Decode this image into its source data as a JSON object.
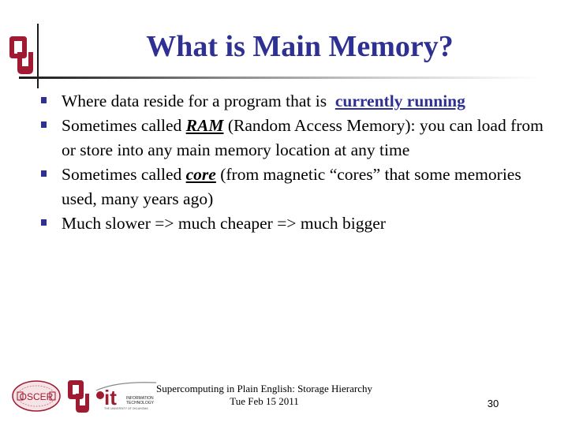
{
  "slide": {
    "title": "What is Main Memory?",
    "bullets": [
      {
        "parts": [
          {
            "text": "Where data reside for a program that is  ",
            "style": "plain"
          },
          {
            "text": "currently running",
            "style": "link"
          }
        ]
      },
      {
        "parts": [
          {
            "text": "Sometimes called ",
            "style": "plain"
          },
          {
            "text": "RAM",
            "style": "emph"
          },
          {
            "text": " (Random Access Memory): you can load from or store into any main memory location at any time",
            "style": "plain"
          }
        ]
      },
      {
        "parts": [
          {
            "text": "Sometimes called ",
            "style": "plain"
          },
          {
            "text": "core",
            "style": "emph"
          },
          {
            "text": " (from magnetic “cores” that some memories used, many years ago)",
            "style": "plain"
          }
        ]
      },
      {
        "parts": [
          {
            "text": "Much slower => much cheaper => much bigger",
            "style": "plain"
          }
        ]
      }
    ]
  },
  "footer": {
    "line1": "Supercomputing in Plain English: Storage Hierarchy",
    "line2": "Tue Feb 15 2011",
    "page_number": "30",
    "logos": {
      "oscer": "OSCER",
      "ou": "OU",
      "it": "it",
      "it_caption_1": "INFORMATION",
      "it_caption_2": "TECHNOLOGY",
      "it_caption_3": "THE UNIVERSITY OF OKLAHOMA"
    }
  },
  "colors": {
    "title": "#2E3192",
    "bullet": "#2E3192",
    "ou_crimson": "#9E1B32"
  }
}
